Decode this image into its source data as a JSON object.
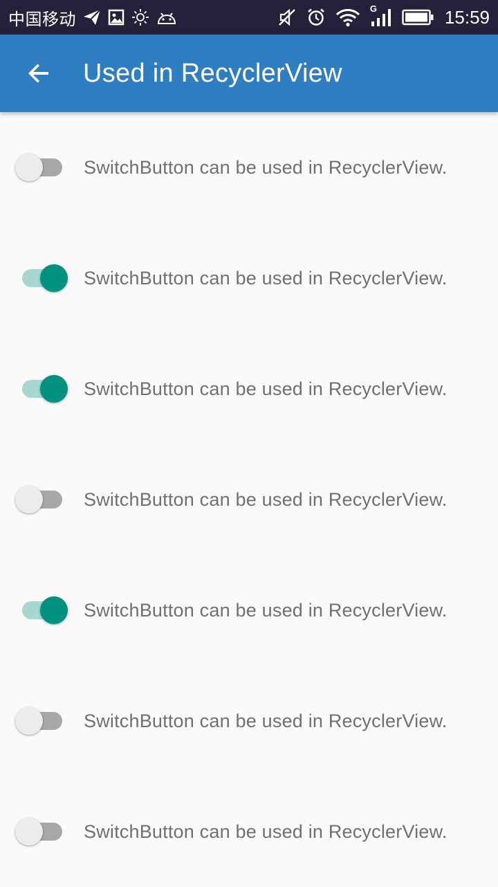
{
  "status_bar": {
    "carrier": "中国移动",
    "network_type": "G",
    "time": "15:59",
    "icons": [
      "send-icon",
      "image-icon",
      "brightness-icon",
      "android-icon",
      "mute-icon",
      "alarm-icon",
      "wifi-icon",
      "signal-icon",
      "battery-icon"
    ]
  },
  "app_bar": {
    "title": "Used in RecyclerView",
    "back_icon": "arrow-back-icon",
    "color": "#2f7ec2"
  },
  "accent_color": "#019180",
  "list": {
    "items": [
      {
        "label": "SwitchButton can be used in RecyclerView.",
        "checked": false
      },
      {
        "label": "SwitchButton can be used in RecyclerView.",
        "checked": true
      },
      {
        "label": "SwitchButton can be used in RecyclerView.",
        "checked": true
      },
      {
        "label": "SwitchButton can be used in RecyclerView.",
        "checked": false
      },
      {
        "label": "SwitchButton can be used in RecyclerView.",
        "checked": true
      },
      {
        "label": "SwitchButton can be used in RecyclerView.",
        "checked": false
      },
      {
        "label": "SwitchButton can be used in RecyclerView.",
        "checked": false
      }
    ]
  }
}
